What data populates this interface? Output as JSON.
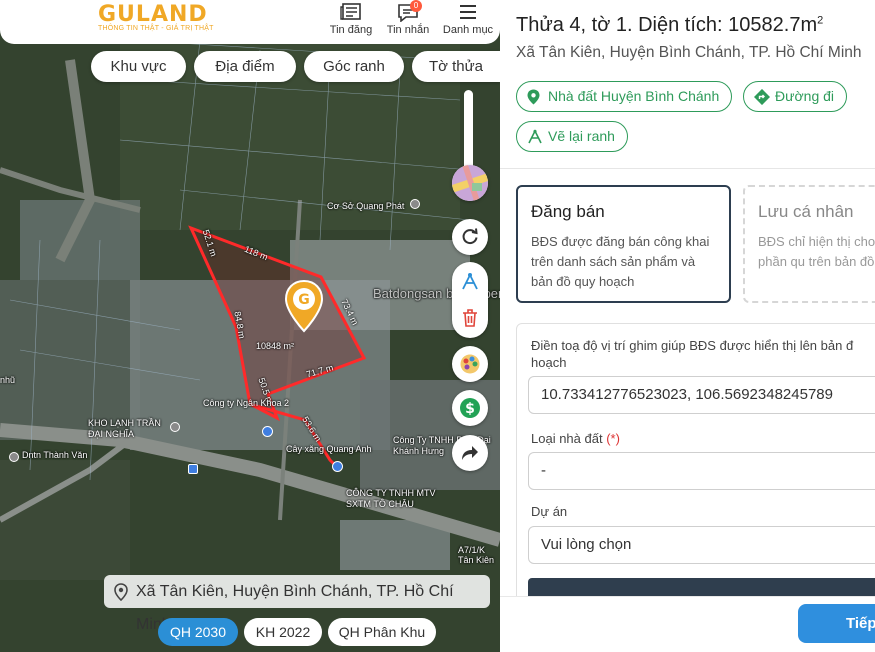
{
  "header": {
    "logo_text": "GULAND",
    "logo_tagline": "THÔNG TIN THẬT - GIÁ TRỊ THẬT",
    "nav": [
      {
        "label": "Tin đăng",
        "icon": "newspaper-icon"
      },
      {
        "label": "Tin nhắn",
        "icon": "chat-icon",
        "badge": "0"
      },
      {
        "label": "Danh mục",
        "icon": "menu-icon"
      }
    ]
  },
  "filters": [
    "Khu vực",
    "Địa điểm",
    "Góc ranh",
    "Tờ thửa"
  ],
  "map": {
    "plot_area_label": "10848 m²",
    "edge_labels": [
      "118 m",
      "52.1 m",
      "73.4 m",
      "71.7 m",
      "84.8 m",
      "50.5 m",
      "53.6 m"
    ],
    "place_labels": [
      "Cơ Sở Quang Phát",
      "Công ty Ngân Khoa 2",
      "KHO LẠNH TRẦN ĐẠI NGHĨA",
      "Dntn Thành Văn",
      "Cây xăng Quang Anh",
      "Công Ty TNHH Phát Đại Khánh Hưng",
      "CÔNG TY TNHH MTV SXTM TÔ CHÂU",
      "Batdongsan by Property",
      "A7/1/K Tân Kiên",
      "nhũ"
    ],
    "watermark": "Batdongsan"
  },
  "tools": [
    "refresh-icon",
    "draw-boundary-icon",
    "delete-icon",
    "palette-icon",
    "price-icon",
    "share-icon"
  ],
  "address_bar": "Xã Tân Kiên, Huyện Bình Chánh, TP. Hồ Chí Minh",
  "layers": [
    {
      "label": "QH 2030",
      "active": true
    },
    {
      "label": "KH 2022",
      "active": false
    },
    {
      "label": "QH Phân Khu",
      "active": false
    }
  ],
  "panel": {
    "title": "Thửa 4, tờ 1. Diện tích: 10582.7m",
    "title_sup": "2",
    "subtitle": "Xã Tân Kiên, Huyện Bình Chánh, TP. Hồ Chí Minh",
    "actions": [
      "Nhà đất Huyện Bình Chánh",
      "Đường đi",
      "Vẽ lại ranh"
    ],
    "cards": [
      {
        "title": "Đăng bán",
        "desc": "BĐS được đăng bán công khai trên danh sách sản phẩm và bản đồ quy hoạch"
      },
      {
        "title": "Lưu cá nhân",
        "desc": "BĐS chỉ hiện thị cho thấy trong phần qu trên bản đồ quy ho"
      }
    ],
    "coord_label": "Điền toạ độ vị trí ghim giúp BĐS được hiển thị lên bản đ hoạch",
    "coord_value": "10.733412776523023, 106.5692348245789",
    "type_label": "Loại nhà đất",
    "type_required": "(*)",
    "type_value": "-",
    "project_label": "Dự án",
    "project_value": "Vui lòng chọn",
    "next_label": "Tiếp"
  },
  "colors": {
    "brand": "#f0a826",
    "accent_green": "#2e9b5a",
    "primary_blue": "#2f8fde",
    "plot_outline": "#ff2a2a"
  }
}
